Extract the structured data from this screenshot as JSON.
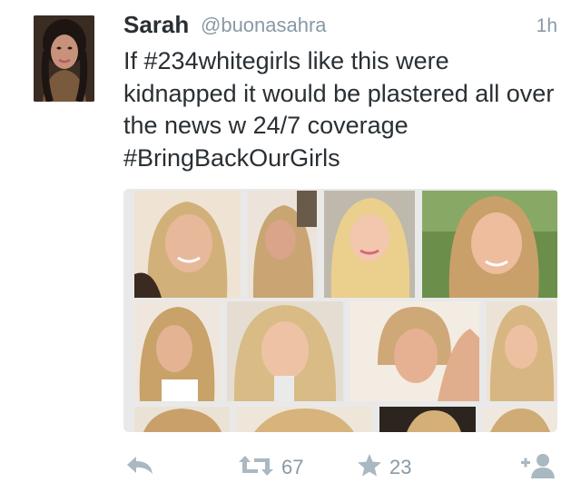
{
  "tweet": {
    "author_name": "Sarah",
    "author_handle": "@buonasahra",
    "timestamp": "1h",
    "text_parts": [
      "If ",
      "#234whitegirls",
      " like this were kidnapped it would be plastered all over the news w 24/7 coverage ",
      "#BringBackOurGirls"
    ]
  },
  "actions": {
    "retweet_count": "67",
    "favorite_count": "23"
  },
  "icons": {
    "reply": "reply-icon",
    "retweet": "retweet-icon",
    "favorite": "star-icon",
    "follow": "follow-icon"
  },
  "colors": {
    "text": "#292f33",
    "muted": "#8899a6",
    "icon": "#aab8c2"
  }
}
